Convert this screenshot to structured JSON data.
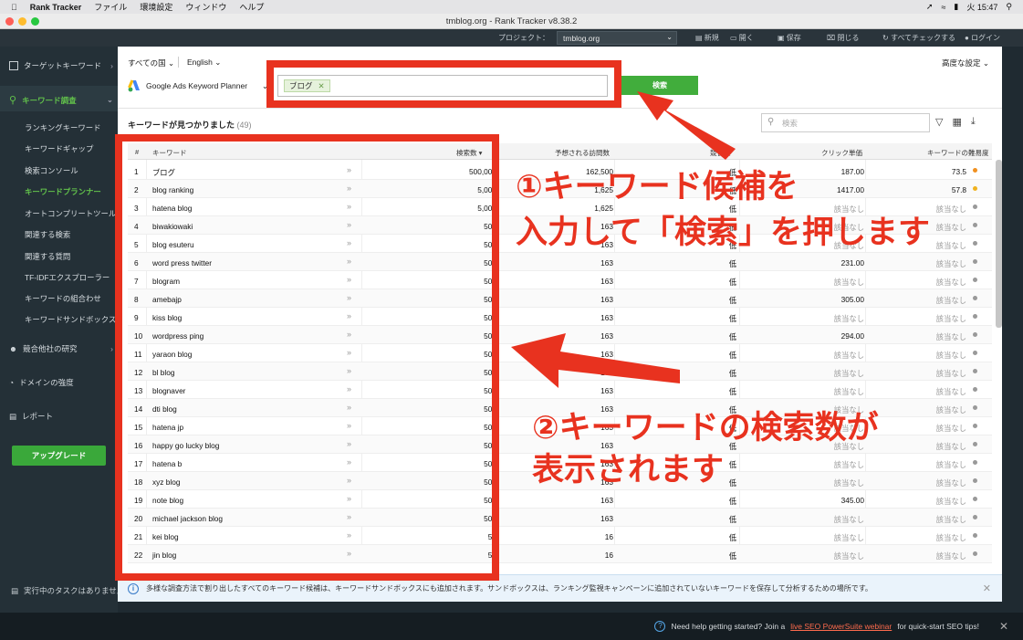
{
  "menubar": {
    "app": "Rank Tracker",
    "items": [
      "ファイル",
      "環境設定",
      "ウィンドウ",
      "ヘルプ"
    ],
    "clock": "火 15:47"
  },
  "window_title": "tmblog.org - Rank Tracker v8.38.2",
  "toolbar": {
    "project_label": "プロジェクト：",
    "project_value": "tmblog.org",
    "new": "新規",
    "open": "開く",
    "save": "保存",
    "close": "閉じる",
    "check_all": "すべてチェックする",
    "login": "ログイン"
  },
  "sidebar": {
    "target_keywords": "ターゲットキーワード",
    "keyword_research": "キーワード調査",
    "items": [
      {
        "label": "ランキングキーワード"
      },
      {
        "label": "キーワードギャップ"
      },
      {
        "label": "検索コンソール"
      },
      {
        "label": "キーワードプランナー"
      },
      {
        "label": "オートコンプリートツール"
      },
      {
        "label": "関連する検索"
      },
      {
        "label": "関連する質問"
      },
      {
        "label": "TF-IDFエクスプローラー"
      },
      {
        "label": "キーワードの組合わせ"
      },
      {
        "label": "キーワードサンドボックス"
      }
    ],
    "competitor_research": "競合他社の研究",
    "domain_strength": "ドメインの強度",
    "reports": "レポート",
    "upgrade": "アップグレード",
    "running_tasks": "実行中のタスクはありません"
  },
  "filters": {
    "country": "すべての国",
    "language": "English",
    "advanced": "高度な設定",
    "source": "Google Ads Keyword Planner",
    "tag": "ブログ",
    "search_button": "検索"
  },
  "results": {
    "title": "キーワードが見つかりました",
    "count": "(49)",
    "search_placeholder": "検索"
  },
  "table": {
    "headers": {
      "num": "#",
      "keyword": "キーワード",
      "volume": "検索数",
      "visits": "予想される訪問数",
      "competition": "競合性",
      "cpc": "クリック単価",
      "difficulty": "キーワードの難易度"
    },
    "rows": [
      {
        "n": "1",
        "kw": "ブログ",
        "vol": "500,000",
        "vis": "162,500",
        "comp": "低",
        "cpc": "187.00",
        "diff": "73.5",
        "dot": "#f0901f"
      },
      {
        "n": "2",
        "kw": "blog ranking",
        "vol": "5,000",
        "vis": "1,625",
        "comp": "低",
        "cpc": "1417.00",
        "diff": "57.8",
        "dot": "#f0b21f"
      },
      {
        "n": "3",
        "kw": "hatena blog",
        "vol": "5,000",
        "vis": "1,625",
        "comp": "低",
        "cpc": "該当なし",
        "diff": "該当なし",
        "dot": "#999"
      },
      {
        "n": "4",
        "kw": "biwakiowaki",
        "vol": "500",
        "vis": "163",
        "comp": "低",
        "cpc": "該当なし",
        "diff": "該当なし",
        "dot": "#999"
      },
      {
        "n": "5",
        "kw": "blog esuteru",
        "vol": "500",
        "vis": "163",
        "comp": "低",
        "cpc": "該当なし",
        "diff": "該当なし",
        "dot": "#999"
      },
      {
        "n": "6",
        "kw": "word press twitter",
        "vol": "500",
        "vis": "163",
        "comp": "低",
        "cpc": "231.00",
        "diff": "該当なし",
        "dot": "#999"
      },
      {
        "n": "7",
        "kw": "blogram",
        "vol": "500",
        "vis": "163",
        "comp": "低",
        "cpc": "該当なし",
        "diff": "該当なし",
        "dot": "#999"
      },
      {
        "n": "8",
        "kw": "amebajp",
        "vol": "500",
        "vis": "163",
        "comp": "低",
        "cpc": "305.00",
        "diff": "該当なし",
        "dot": "#999"
      },
      {
        "n": "9",
        "kw": "kiss blog",
        "vol": "500",
        "vis": "163",
        "comp": "低",
        "cpc": "該当なし",
        "diff": "該当なし",
        "dot": "#999"
      },
      {
        "n": "10",
        "kw": "wordpress ping",
        "vol": "500",
        "vis": "163",
        "comp": "低",
        "cpc": "294.00",
        "diff": "該当なし",
        "dot": "#999"
      },
      {
        "n": "11",
        "kw": "yaraon blog",
        "vol": "500",
        "vis": "163",
        "comp": "低",
        "cpc": "該当なし",
        "diff": "該当なし",
        "dot": "#999"
      },
      {
        "n": "12",
        "kw": "bl blog",
        "vol": "500",
        "vis": "163",
        "comp": "低",
        "cpc": "該当なし",
        "diff": "該当なし",
        "dot": "#999"
      },
      {
        "n": "13",
        "kw": "blognaver",
        "vol": "500",
        "vis": "163",
        "comp": "低",
        "cpc": "該当なし",
        "diff": "該当なし",
        "dot": "#999"
      },
      {
        "n": "14",
        "kw": "dti blog",
        "vol": "500",
        "vis": "163",
        "comp": "低",
        "cpc": "該当なし",
        "diff": "該当なし",
        "dot": "#999"
      },
      {
        "n": "15",
        "kw": "hatena jp",
        "vol": "500",
        "vis": "163",
        "comp": "低",
        "cpc": "該当なし",
        "diff": "該当なし",
        "dot": "#999"
      },
      {
        "n": "16",
        "kw": "happy go lucky blog",
        "vol": "500",
        "vis": "163",
        "comp": "低",
        "cpc": "該当なし",
        "diff": "該当なし",
        "dot": "#999"
      },
      {
        "n": "17",
        "kw": "hatena b",
        "vol": "500",
        "vis": "163",
        "comp": "低",
        "cpc": "該当なし",
        "diff": "該当なし",
        "dot": "#999"
      },
      {
        "n": "18",
        "kw": "xyz blog",
        "vol": "500",
        "vis": "163",
        "comp": "低",
        "cpc": "該当なし",
        "diff": "該当なし",
        "dot": "#999"
      },
      {
        "n": "19",
        "kw": "note blog",
        "vol": "500",
        "vis": "163",
        "comp": "低",
        "cpc": "345.00",
        "diff": "該当なし",
        "dot": "#999"
      },
      {
        "n": "20",
        "kw": "michael jackson blog",
        "vol": "500",
        "vis": "163",
        "comp": "低",
        "cpc": "該当なし",
        "diff": "該当なし",
        "dot": "#999"
      },
      {
        "n": "21",
        "kw": "kei blog",
        "vol": "50",
        "vis": "16",
        "comp": "低",
        "cpc": "該当なし",
        "diff": "該当なし",
        "dot": "#999"
      },
      {
        "n": "22",
        "kw": "jin blog",
        "vol": "50",
        "vis": "16",
        "comp": "低",
        "cpc": "該当なし",
        "diff": "該当なし",
        "dot": "#999"
      }
    ]
  },
  "infobar": "多様な調査方法で割り出したすべてのキーワード候補は、キーワードサンドボックスにも追加されます。サンドボックスは、ランキング監視キャンペーンに追加されていないキーワードを保存して分析するための場所です。",
  "footer": {
    "prefix": "Need help getting started? Join a",
    "link": "live SEO PowerSuite webinar",
    "suffix": "for quick-start SEO tips!"
  },
  "annotations": {
    "step1_line1": "①キーワード候補を",
    "step1_line2": "入力して「検索」を押します",
    "step2_line1": "②キーワードの検索数が",
    "step2_line2": "表示されます"
  },
  "colors": {
    "accent_green": "#41ad3c",
    "annotation_red": "#e8321f",
    "sidebar_bg": "#243037"
  }
}
